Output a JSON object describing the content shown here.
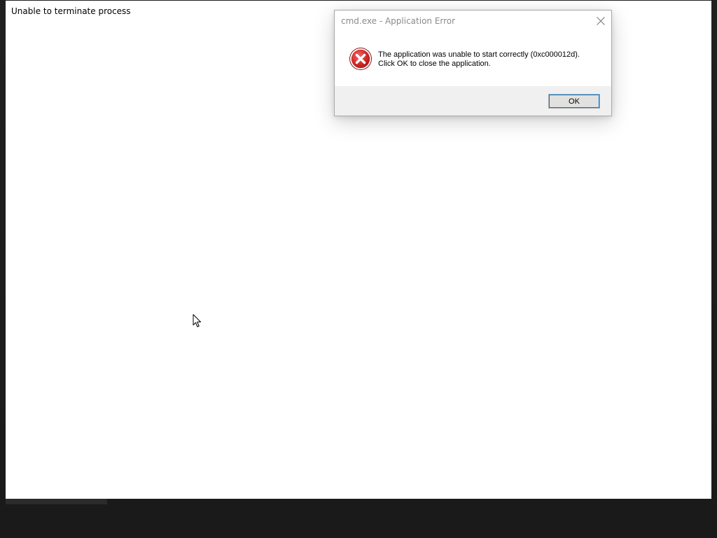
{
  "main_window": {
    "title": "Unable to terminate process"
  },
  "dialog": {
    "title": "cmd.exe - Application Error",
    "message_line1": "The application was unable to start correctly (0xc000012d).",
    "message_line2": "Click OK to close the application.",
    "ok_label": "OK",
    "icon": "error-icon",
    "close_icon": "close-icon"
  },
  "colors": {
    "error_red": "#c8202a",
    "title_text": "#8a8a8a",
    "footer_bg": "#f0f0f0",
    "focus_blue": "#0078d7"
  }
}
